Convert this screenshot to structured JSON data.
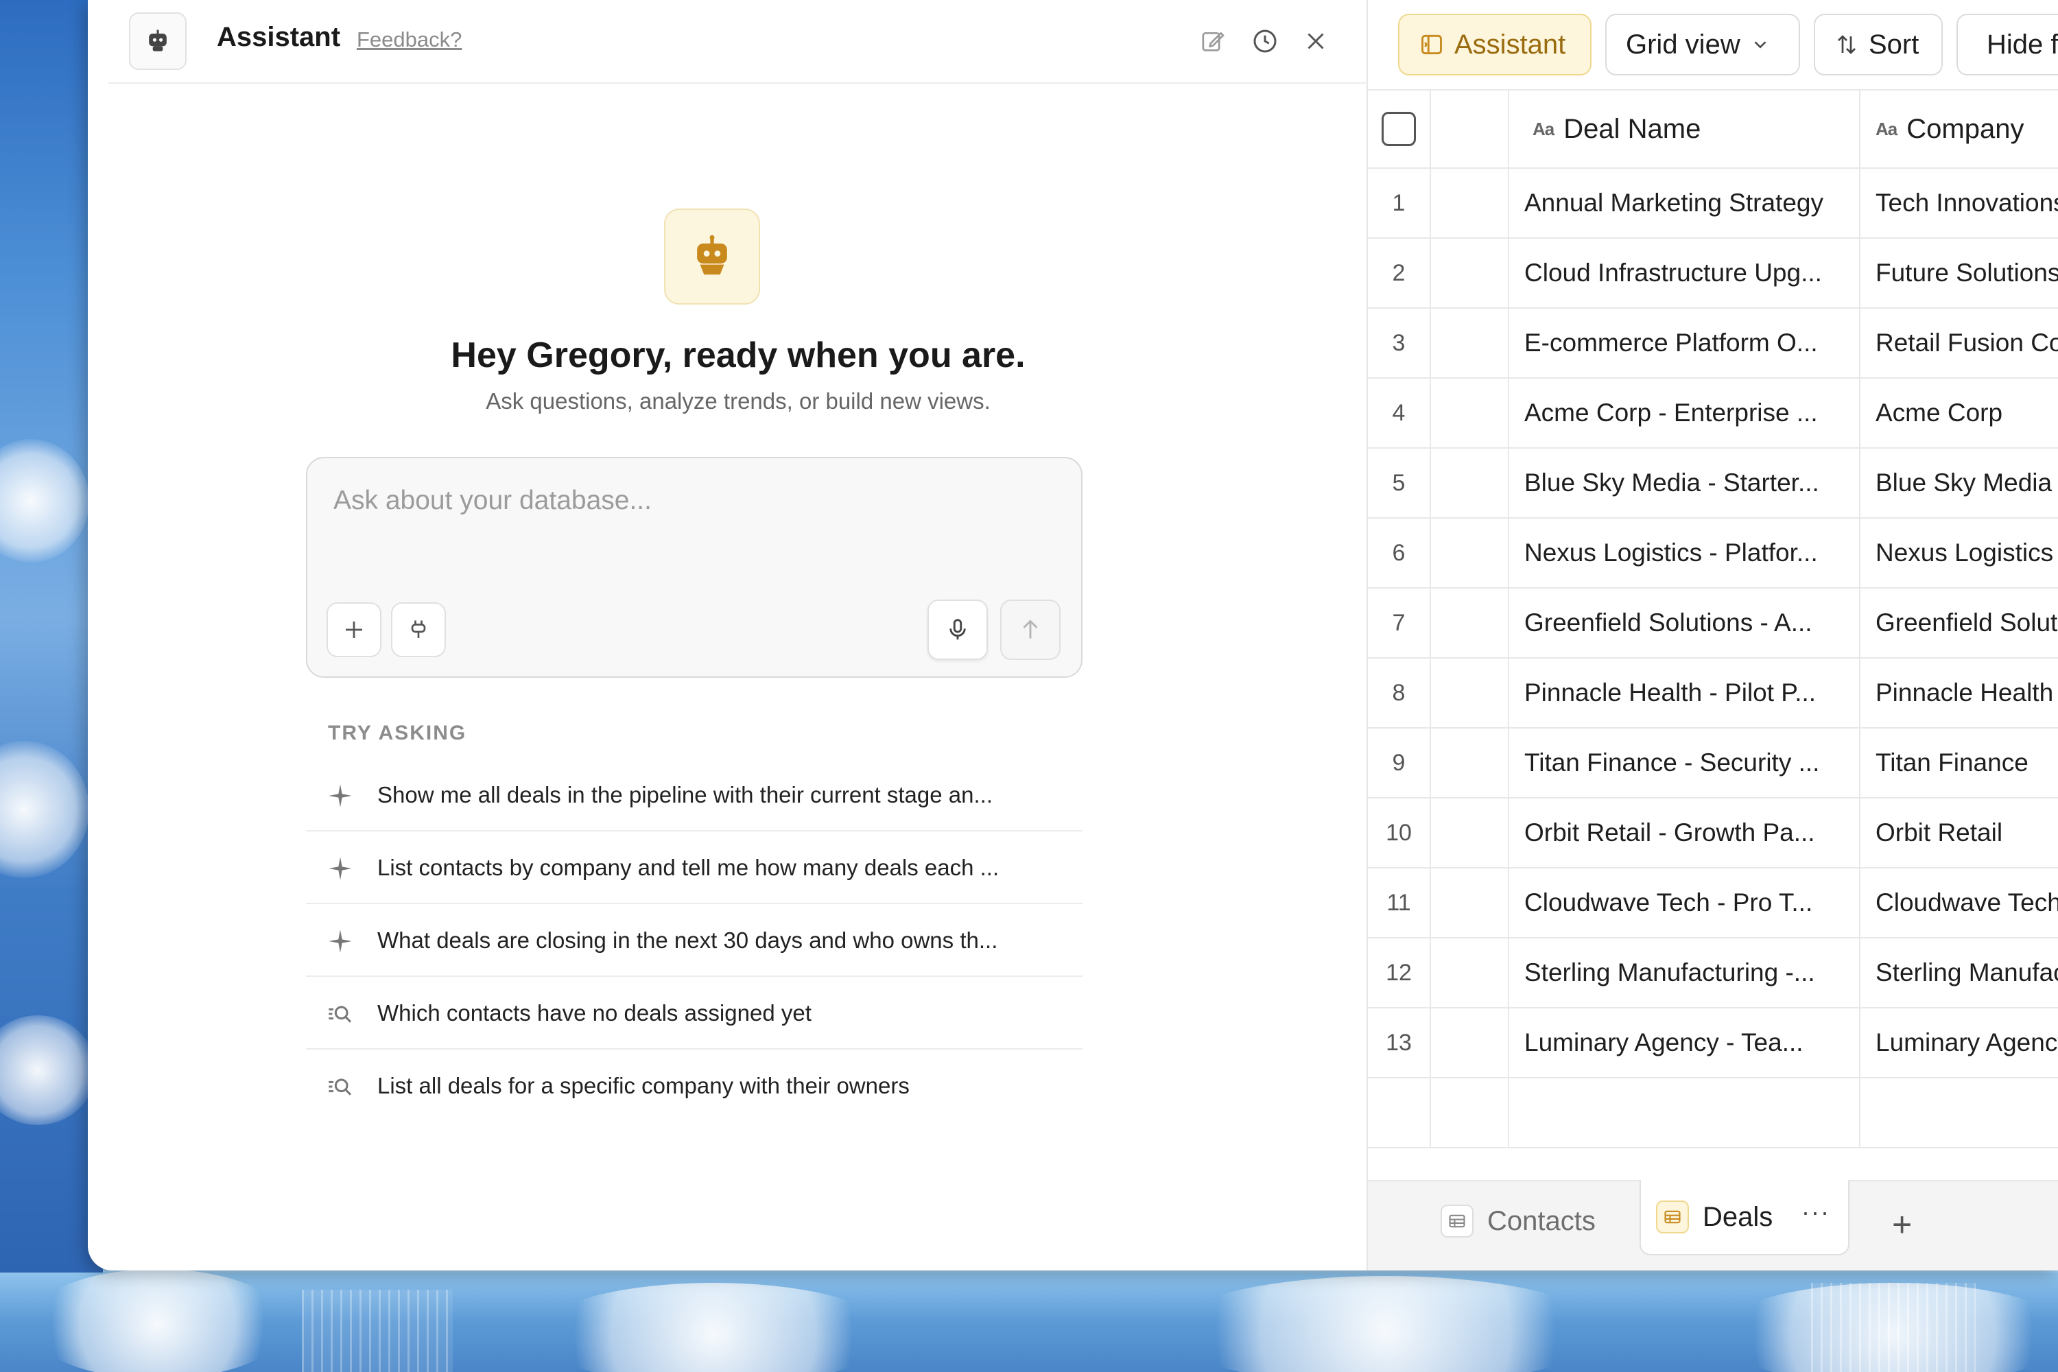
{
  "colors": {
    "accent": "#c88a1d",
    "accent_bg": "#fdf5dc",
    "panel_bg": "#ffffff",
    "border": "#e6e6e6"
  },
  "assistant": {
    "title": "Assistant",
    "feedback_link": "Feedback?",
    "header_icons": [
      "robot-icon",
      "edit-icon",
      "history-icon",
      "close-icon"
    ],
    "greeting": "Hey Gregory, ready when you are.",
    "subtitle": "Ask questions, analyze trends, or build new views.",
    "composer": {
      "placeholder": "Ask about your database...",
      "value": "",
      "icons": [
        "plus-icon",
        "plug-icon",
        "microphone-icon",
        "send-arrow-icon"
      ]
    },
    "try_asking_label": "TRY ASKING",
    "suggestions": [
      {
        "icon": "sparkle-icon",
        "text": "Show me all deals in the pipeline with their current stage an..."
      },
      {
        "icon": "sparkle-icon",
        "text": "List contacts by company and tell me how many deals each ..."
      },
      {
        "icon": "sparkle-icon",
        "text": "What deals are closing in the next 30 days and who owns th..."
      },
      {
        "icon": "search-list-icon",
        "text": "Which contacts have no deals assigned yet"
      },
      {
        "icon": "search-list-icon",
        "text": "List all deals for a specific company with their owners"
      }
    ]
  },
  "toolbar": {
    "assistant_label": "Assistant",
    "view_label": "Grid view",
    "sort_label": "Sort",
    "hide_fields_label": "Hide fields"
  },
  "grid": {
    "columns": [
      {
        "name": "Deal Name",
        "type_glyph": "Aa"
      },
      {
        "name": "Company",
        "type_glyph": "Aa"
      }
    ],
    "rows": [
      {
        "num": "1",
        "deal": "Annual Marketing Strategy",
        "company": "Tech Innovations LLC"
      },
      {
        "num": "2",
        "deal": "Cloud Infrastructure Upg...",
        "company": "Future Solutions Inc."
      },
      {
        "num": "3",
        "deal": "E-commerce Platform O...",
        "company": "Retail Fusion Corp."
      },
      {
        "num": "4",
        "deal": "Acme Corp - Enterprise ...",
        "company": "Acme Corp"
      },
      {
        "num": "5",
        "deal": "Blue Sky Media - Starter...",
        "company": "Blue Sky Media"
      },
      {
        "num": "6",
        "deal": "Nexus Logistics - Platfor...",
        "company": "Nexus Logistics"
      },
      {
        "num": "7",
        "deal": "Greenfield Solutions - A...",
        "company": "Greenfield Solutions"
      },
      {
        "num": "8",
        "deal": "Pinnacle Health - Pilot P...",
        "company": "Pinnacle Health"
      },
      {
        "num": "9",
        "deal": "Titan Finance - Security ...",
        "company": "Titan Finance"
      },
      {
        "num": "10",
        "deal": "Orbit Retail - Growth Pa...",
        "company": "Orbit Retail"
      },
      {
        "num": "11",
        "deal": "Cloudwave Tech - Pro T...",
        "company": "Cloudwave Tech"
      },
      {
        "num": "12",
        "deal": "Sterling Manufacturing -...",
        "company": "Sterling Manufacturing"
      },
      {
        "num": "13",
        "deal": "Luminary Agency - Tea...",
        "company": "Luminary Agency"
      }
    ]
  },
  "tabs": [
    {
      "label": "Contacts",
      "active": false
    },
    {
      "label": "Deals",
      "active": true
    }
  ],
  "tab_more": "···",
  "tab_add": "+"
}
